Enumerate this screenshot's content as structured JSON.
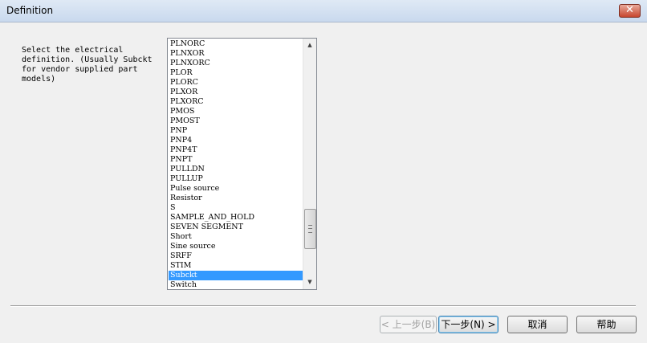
{
  "window": {
    "title": "Definition",
    "close_glyph": "✕"
  },
  "prompt": {
    "text": "Select the electrical\ndefinition. (Usually Subckt\nfor vendor supplied part\nmodels)"
  },
  "listbox": {
    "items": [
      "PLNORC",
      "PLNXOR",
      "PLNXORC",
      "PLOR",
      "PLORC",
      "PLXOR",
      "PLXORC",
      "PMOS",
      "PMOST",
      "PNP",
      "PNP4",
      "PNP4T",
      "PNPT",
      "PULLDN",
      "PULLUP",
      "Pulse source",
      "Resistor",
      "S",
      "SAMPLE_AND_HOLD",
      "SEVEN SEGMENT",
      "Short",
      "Sine source",
      "SRFF",
      "STIM",
      "Subckt",
      "Switch"
    ],
    "selected": "Subckt",
    "scroll_up_icon": "triangle-up",
    "scroll_down_icon": "triangle-down"
  },
  "buttons": {
    "back": "< 上一步(B)",
    "next": "下一步(N) >",
    "cancel": "取消",
    "help": "帮助"
  },
  "colors": {
    "selection": "#3399ff",
    "background": "#f0f0f0"
  }
}
